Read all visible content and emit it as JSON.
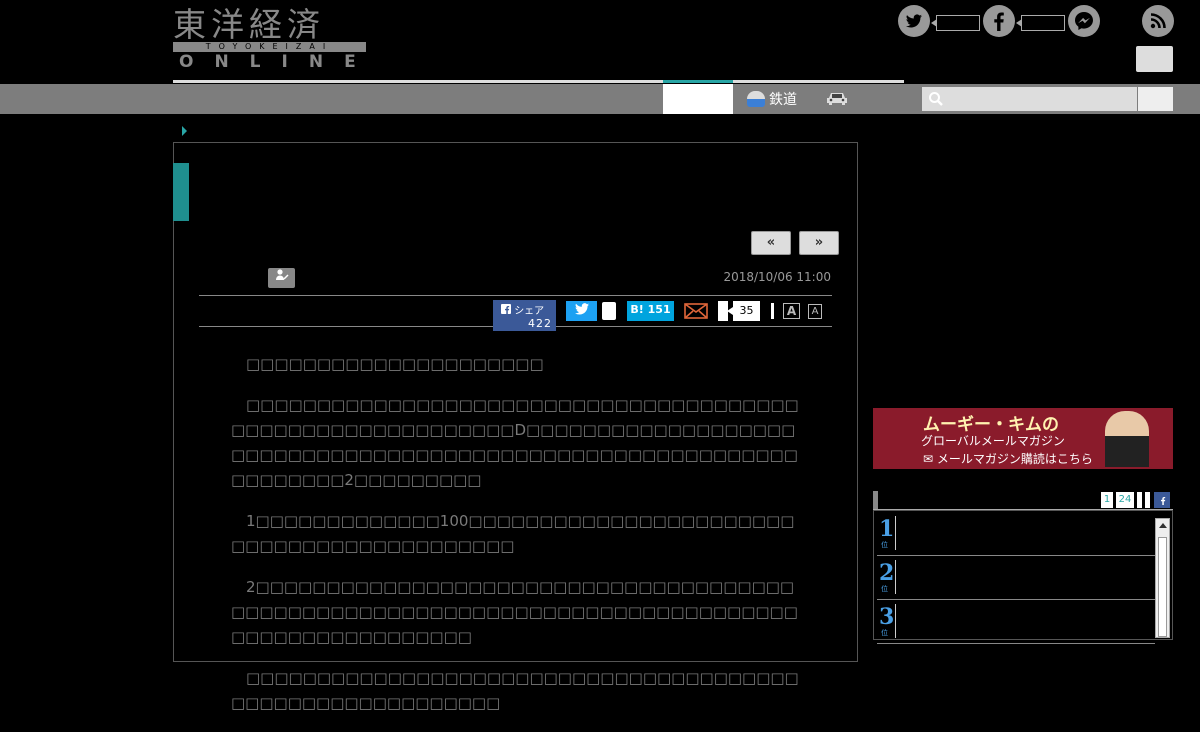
{
  "header": {
    "logo_kanji": "東洋経済",
    "logo_band": "TOYOKEIZAI",
    "logo_online": "ONLINE"
  },
  "nav": {
    "rail_label": "鉄道",
    "search_placeholder": ""
  },
  "article": {
    "prev_label": "«",
    "next_label": "»",
    "date": "2018/10/06 11:00",
    "share": {
      "facebook_label": "シェア",
      "facebook_count": "422",
      "hatena_label": "B!",
      "hatena_count": "151",
      "comment_count": "35"
    },
    "font_large": "A",
    "font_small": "A",
    "paragraphs": [
      "　□□□□□□□□□□□□□□□□□□□□□",
      "　□□□□□□□□□□□□□□□□□□□□□□□□□□□□□□□□□□□□□□□□□□□□□□□□□□□□□□□□□□□D□□□□□□□□□□□□□□□□□□□□□□□□□□□□□□□□□□□□□□□□□□□□□□□□□□□□□□□□□□□□□□□□□□□2□□□□□□□□□",
      "　1□□□□□□□□□□□□□100□□□□□□□□□□□□□□□□□□□□□□□□□□□□□□□□□□□□□□□□□□□",
      "　2□□□□□□□□□□□□□□□□□□□□□□□□□□□□□□□□□□□□□□□□□□□□□□□□□□□□□□□□□□□□□□□□□□□□□□□□□□□□□□□□□□□□□□□□□□□□□□□",
      "　□□□□□□□□□□□□□□□□□□□□□□□□□□□□□□□□□□□□□□□□□□□□□□□□□□□□□□□□□□"
    ]
  },
  "sidebar": {
    "banner": {
      "line1": "ムーギー・キムの",
      "line2": "グローバルメールマガジン",
      "line3": "✉ メールマガジン購読はこちら"
    },
    "ranking_tabs": [
      "1",
      "24"
    ],
    "ranks": [
      {
        "num": "1",
        "sub": "位"
      },
      {
        "num": "2",
        "sub": "位"
      },
      {
        "num": "3",
        "sub": "位"
      }
    ]
  },
  "colors": {
    "accent": "#29a6a6",
    "facebook": "#3b5998",
    "twitter": "#1da1f2",
    "hatena": "#00a4de",
    "navbar": "#7d7d7d"
  }
}
